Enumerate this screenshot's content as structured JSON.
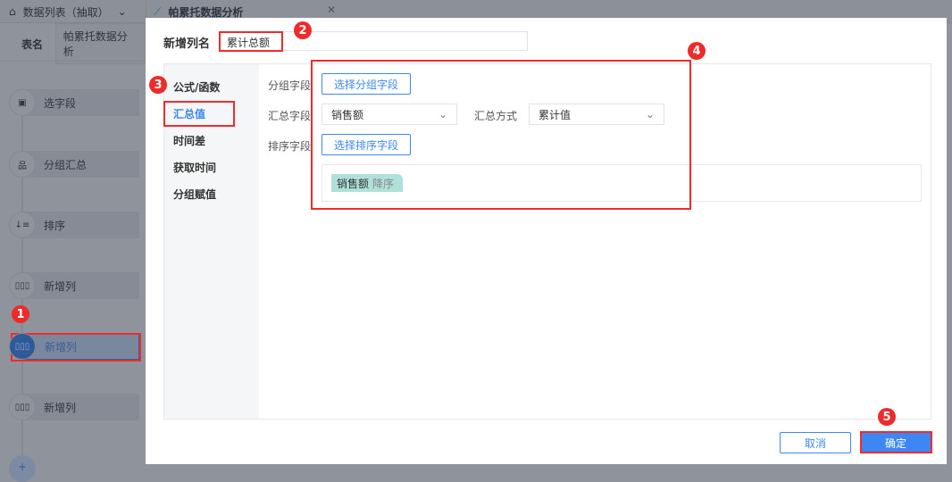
{
  "tabs": [
    {
      "label": "数据列表（抽取）",
      "icon": "home-icon"
    },
    {
      "label": "帕累托数据分析",
      "icon": "chart-line-icon"
    }
  ],
  "table_name": {
    "label": "表名",
    "value": "帕累托数据分析"
  },
  "steps": [
    {
      "label": "选字段"
    },
    {
      "label": "分组汇总"
    },
    {
      "label": "排序"
    },
    {
      "label": "新增列"
    },
    {
      "label": "新增列"
    },
    {
      "label": "新增列"
    }
  ],
  "add_step": "+",
  "modal": {
    "name_label": "新增列名",
    "name_value": "累计总额",
    "menu": [
      "公式/函数",
      "汇总值",
      "时间差",
      "获取时间",
      "分组赋值"
    ],
    "group_label": "分组字段",
    "group_button": "选择分组字段",
    "sum_field_label": "汇总字段",
    "sum_field_value": "销售额",
    "sum_method_label": "汇总方式",
    "sum_method_value": "累计值",
    "sort_label": "排序字段",
    "sort_button": "选择排序字段",
    "sort_tag": {
      "field": "销售额",
      "order": "降序"
    },
    "cancel": "取消",
    "confirm": "确定"
  },
  "annotations": [
    "1",
    "2",
    "3",
    "4",
    "5"
  ]
}
